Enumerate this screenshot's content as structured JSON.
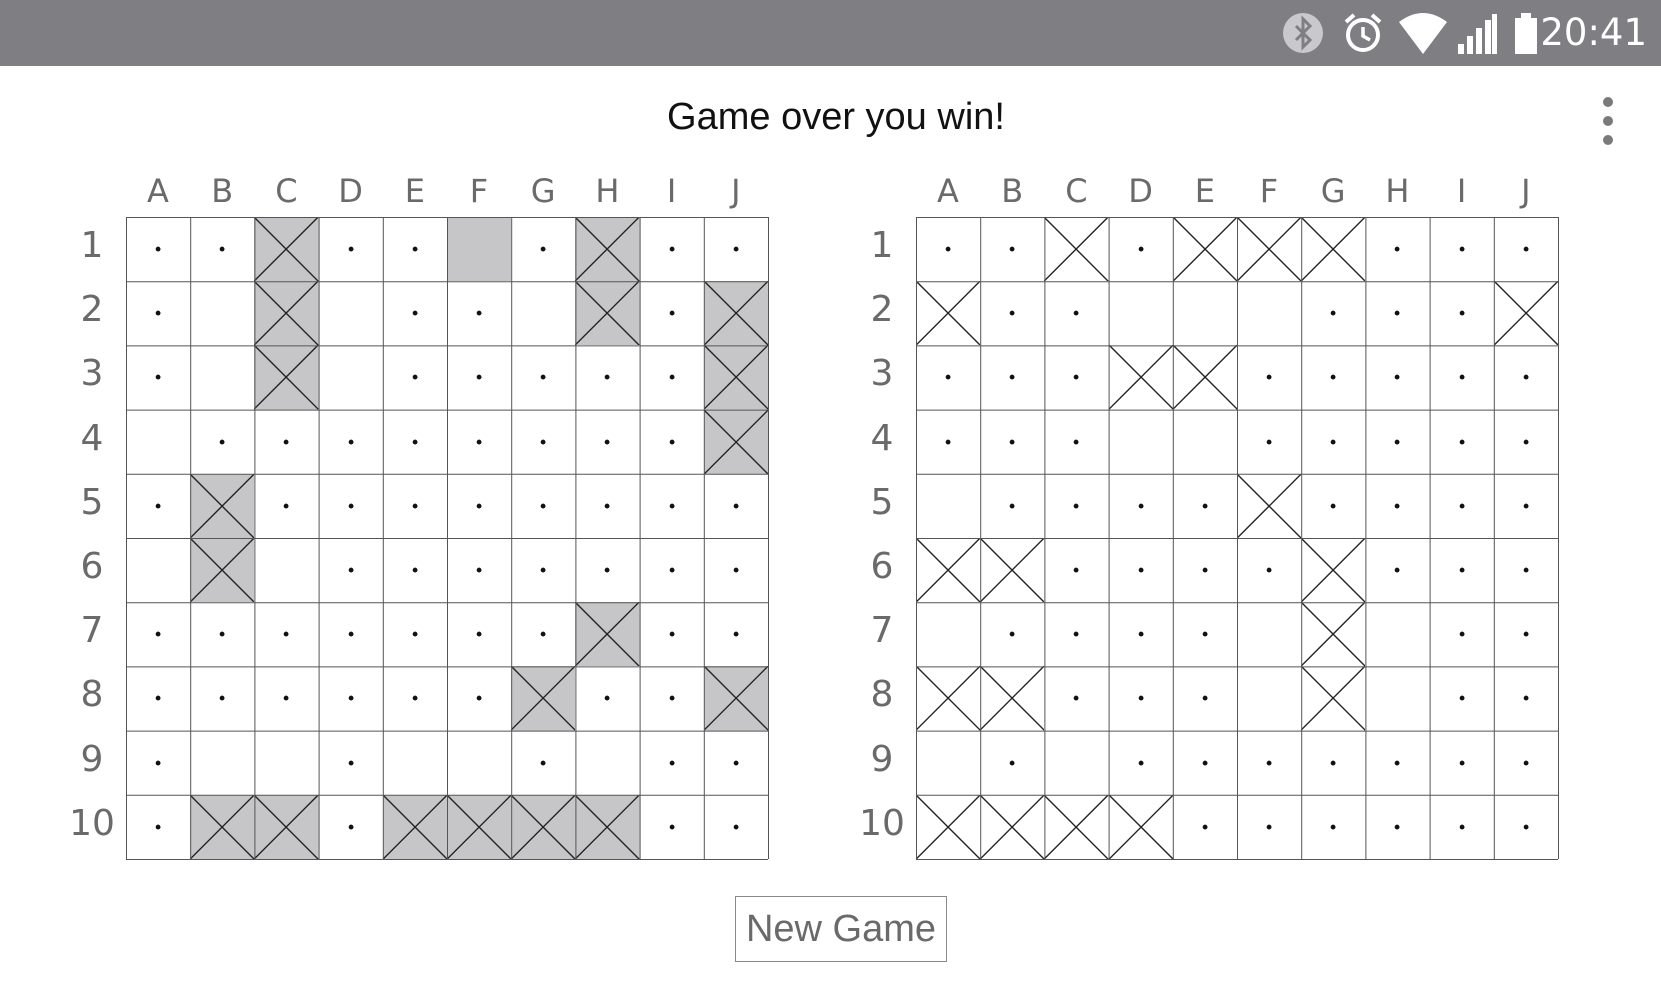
{
  "status_bar": {
    "time": "20:41",
    "icons": [
      "bluetooth-icon",
      "alarm-icon",
      "wifi-icon",
      "signal-icon",
      "battery-icon"
    ],
    "background": "#7f7e82"
  },
  "header": {
    "title": "Game over you win!",
    "menu_icon": "more-vert-icon"
  },
  "columns": [
    "A",
    "B",
    "C",
    "D",
    "E",
    "F",
    "G",
    "H",
    "I",
    "J"
  ],
  "rows": [
    "1",
    "2",
    "3",
    "4",
    "5",
    "6",
    "7",
    "8",
    "9",
    "10"
  ],
  "legend": {
    "dot": "miss",
    "x": "hit",
    "gray": "ship"
  },
  "boards": {
    "player": {
      "cells": [
        ". . X . . S . X . .",
        ". _ X _ . . _ X . X",
        ". _ X _ . . . . . X",
        "_ . . . . . . . . X",
        ". X . . . . . . . .",
        "_ X _ . . . . . . .",
        ". . . . . . . X . .",
        ". . . . . . X . . X",
        ". _ _ . _ _ . _ . .",
        ". X X . X X X X . ."
      ]
    },
    "opponent": {
      "cells": [
        ". . x . x x x . . .",
        "x . . _ _ _ . . . x",
        ". . . x x . . . . .",
        ". . . _ _ . . . . .",
        "_ . . . . x . . . .",
        "x x . . . . x . . .",
        "_ . . . . _ x _ . .",
        "x x . . . _ x _ . .",
        "_ . _ . . . . . . .",
        "x x x x . . . . . ."
      ]
    }
  },
  "new_game_button": {
    "label": "New Game"
  },
  "colors": {
    "ship_gray": "#c6c6c8",
    "grid_line": "#444444",
    "text_gray": "#6a6a6a"
  }
}
